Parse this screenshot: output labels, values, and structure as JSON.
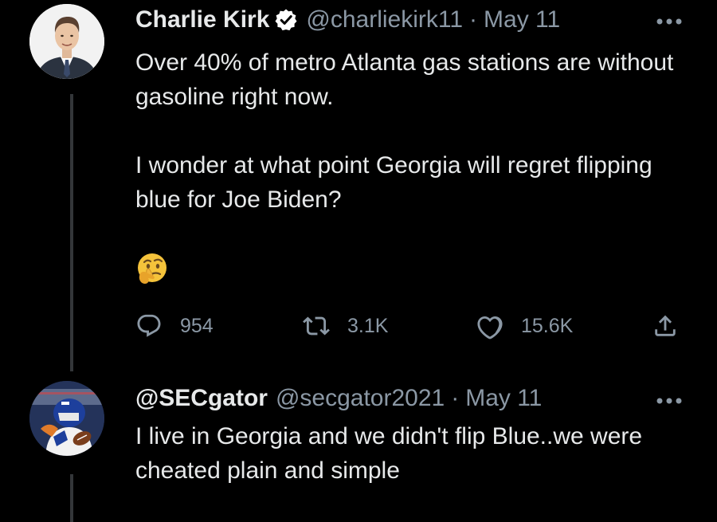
{
  "tweets": [
    {
      "name": "Charlie Kirk",
      "verified": true,
      "handle": "@charliekirk11",
      "separator": "·",
      "date": "May 11",
      "text": "Over 40% of metro Atlanta gas stations are without gasoline right now.\n\nI wonder at what point Georgia will regret flipping blue for Joe Biden?",
      "emoji": "thinking-face-icon",
      "actions": {
        "replies": "954",
        "retweets": "3.1K",
        "likes": "15.6K"
      }
    },
    {
      "name": "@SECgator",
      "verified": false,
      "handle": "@secgator2021",
      "separator": "·",
      "date": "May 11",
      "text": "I live in Georgia and we didn't flip Blue..we were cheated plain and simple"
    }
  ],
  "colors": {
    "background": "#000000",
    "text": "#e7e9ea",
    "secondary": "#8b98a5",
    "thread_line": "#333639",
    "verified_badge": "#ffffff"
  }
}
